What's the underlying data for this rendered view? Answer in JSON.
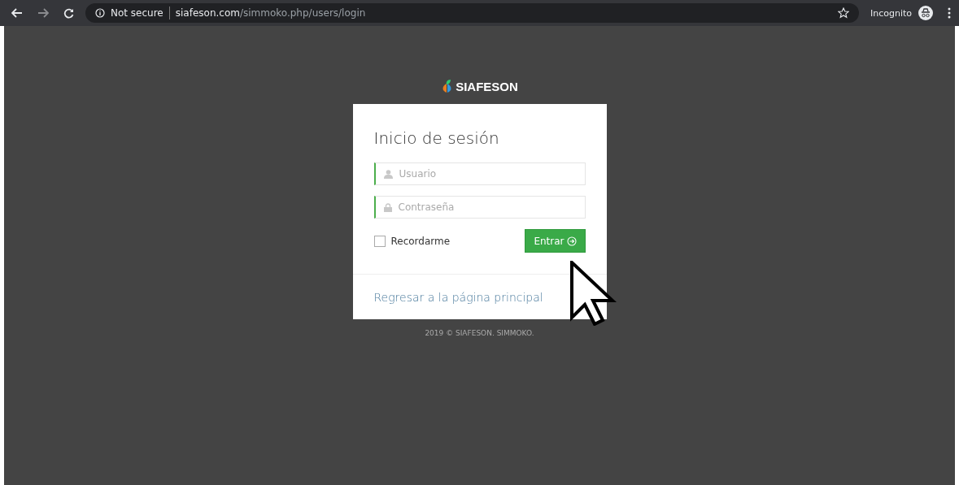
{
  "browser": {
    "security": "Not secure",
    "url_domain": "siafeson.com",
    "url_path": "/simmoko.php/users/login",
    "profile": "Incognito"
  },
  "brand": {
    "name": "SIAFESON"
  },
  "login": {
    "title": "Inicio de sesión",
    "fields": [
      {
        "kind": "user",
        "placeholder": "Usuario"
      },
      {
        "kind": "password",
        "placeholder": "Contraseña"
      }
    ],
    "remember": {
      "label": "Recordarme",
      "checked": false
    },
    "submit": "Entrar",
    "back_link": "Regresar a la página principal"
  },
  "footer": "2019 © SIAFESON. SIMMOKO."
}
